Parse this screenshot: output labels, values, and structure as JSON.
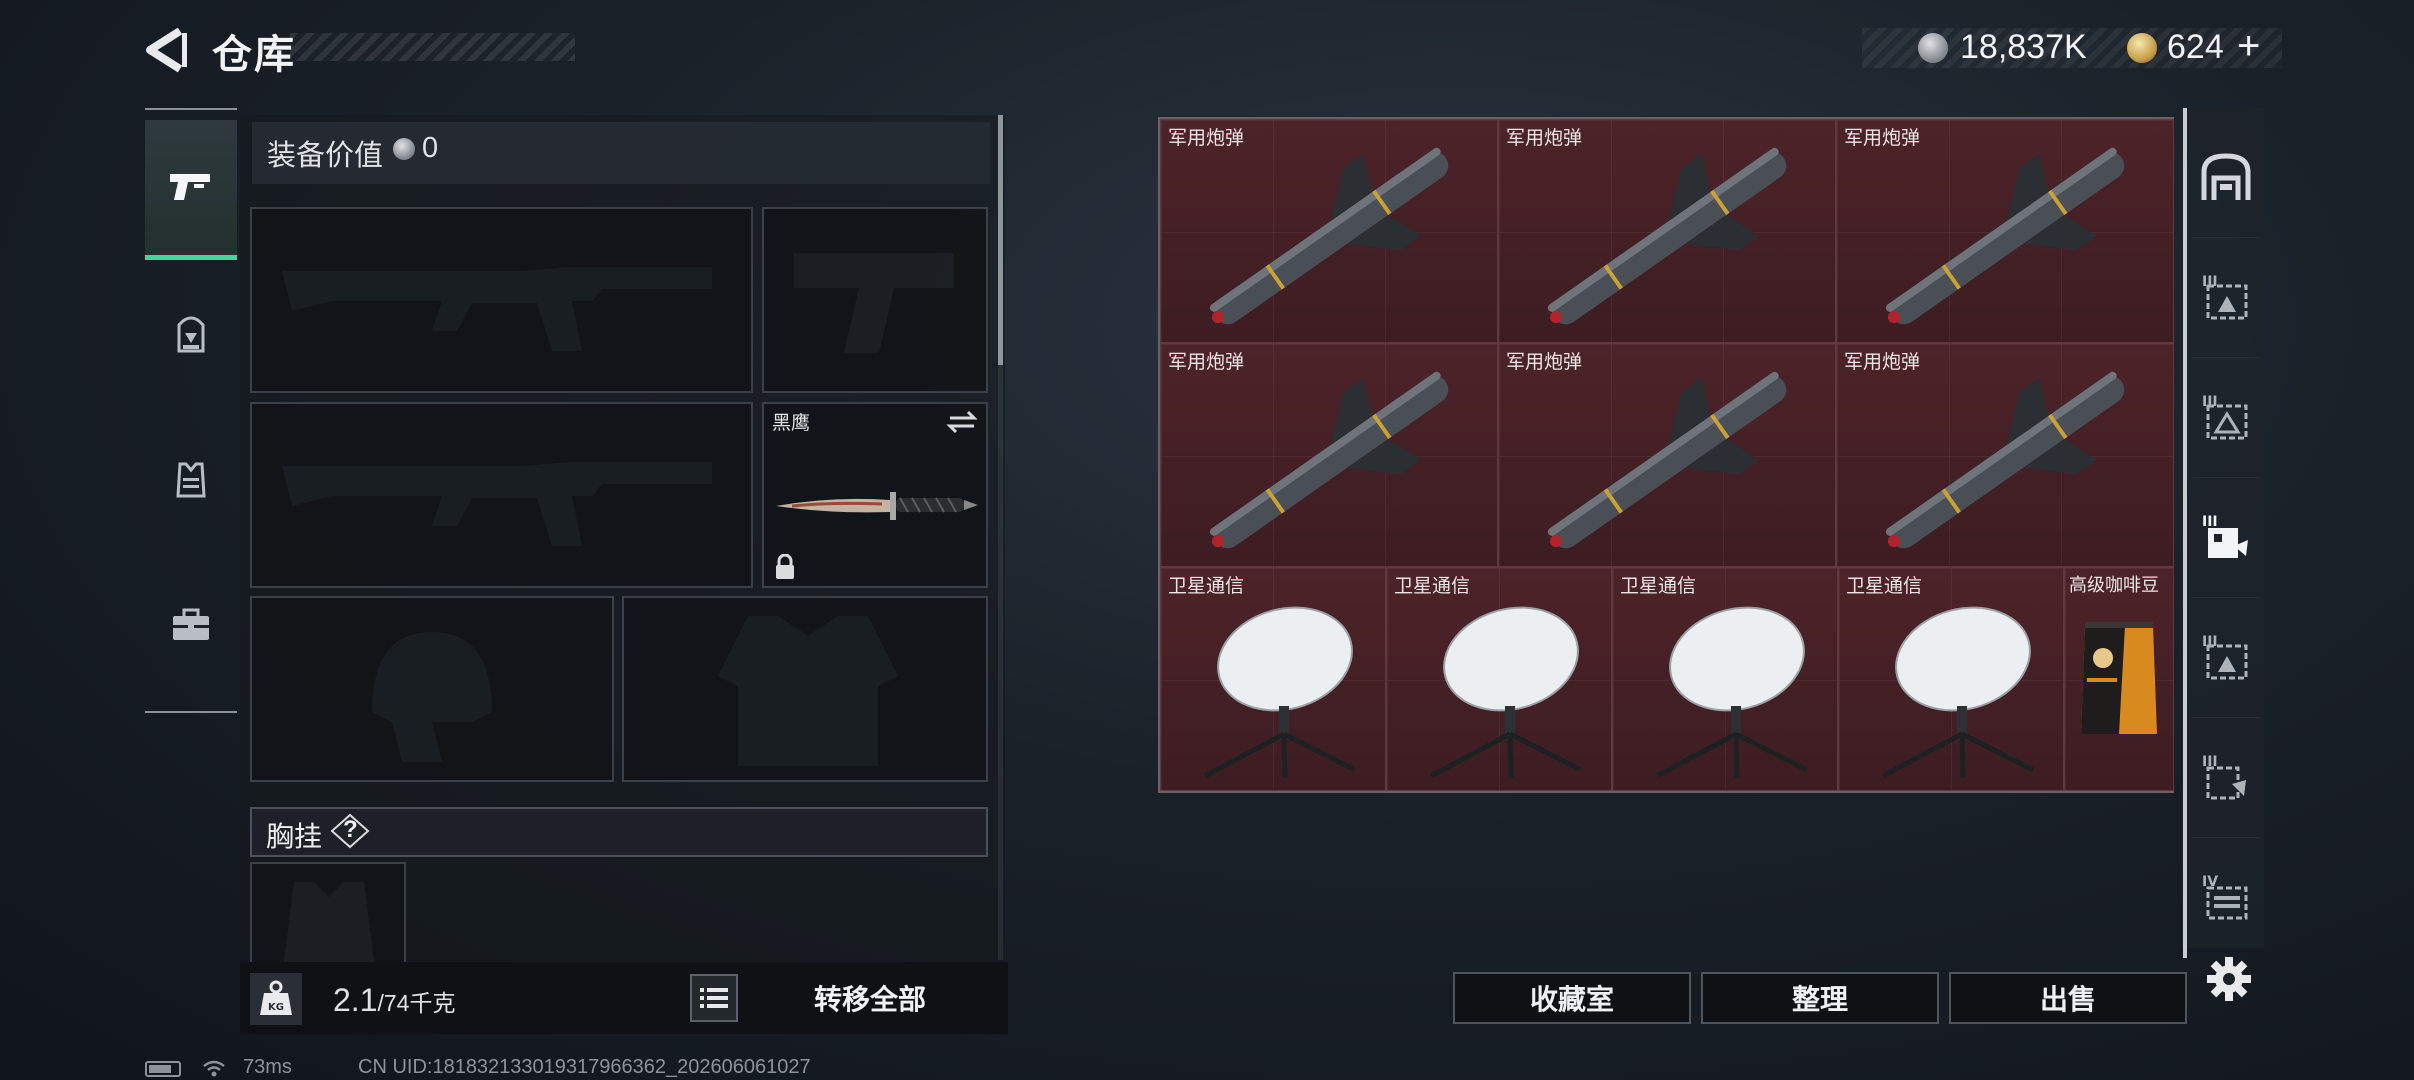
{
  "header": {
    "title": "仓库",
    "currency_primary": "18,837K",
    "currency_secondary": "624",
    "add_label": "+"
  },
  "tabs": [
    {
      "name": "weapons",
      "icon": "pistol-icon",
      "active": true
    },
    {
      "name": "backpack",
      "icon": "backpack-icon",
      "active": false
    },
    {
      "name": "vest",
      "icon": "vest-icon",
      "active": false
    },
    {
      "name": "case",
      "icon": "briefcase-icon",
      "active": false
    }
  ],
  "equipment": {
    "value_label": "装备价值",
    "value": "0",
    "melee_name": "黑鹰",
    "chest_label": "胸挂",
    "help": "?"
  },
  "bottom_left": {
    "weight_current": "2.1",
    "weight_max": "/74千克",
    "transfer_all": "转移全部"
  },
  "grid_items": [
    {
      "name": "军用炮弹",
      "type": "missile"
    },
    {
      "name": "军用炮弹",
      "type": "missile"
    },
    {
      "name": "军用炮弹",
      "type": "missile"
    },
    {
      "name": "军用炮弹",
      "type": "missile"
    },
    {
      "name": "军用炮弹",
      "type": "missile"
    },
    {
      "name": "军用炮弹",
      "type": "missile"
    },
    {
      "name": "卫星通信",
      "type": "dish"
    },
    {
      "name": "卫星通信",
      "type": "dish"
    },
    {
      "name": "卫星通信",
      "type": "dish"
    },
    {
      "name": "卫星通信",
      "type": "dish"
    },
    {
      "name": "高级咖啡豆",
      "type": "coffee"
    }
  ],
  "categories": [
    "armory-icon",
    "tier3-case-icon",
    "tier3-bag-icon",
    "tier3-gear-icon",
    "tier3-case-icon",
    "tier3-item-icon",
    "tier4-storage-icon"
  ],
  "bottom_right": {
    "collection": "收藏室",
    "organize": "整理",
    "sell": "出售"
  },
  "status": {
    "ping": "73ms",
    "uid": "CN UID:18183213301931796636​2_202606061027"
  },
  "colors": {
    "accent_green": "#3fd79a",
    "cell_red": "#4a2228"
  }
}
